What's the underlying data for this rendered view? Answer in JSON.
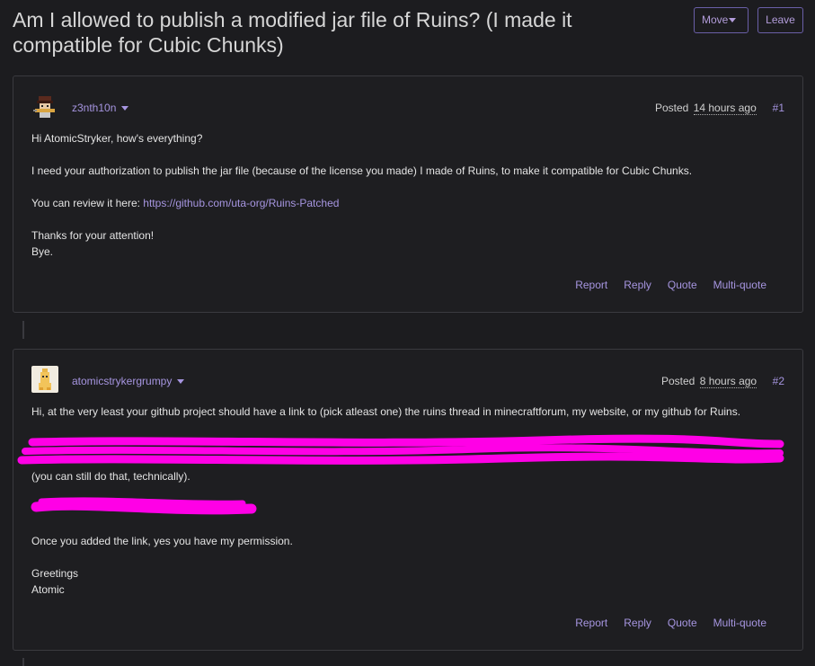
{
  "topic": {
    "title": "Am I allowed to publish a modified jar file of Ruins? (I made it compatible for Cubic Chunks)",
    "move_label": "Move",
    "leave_label": "Leave"
  },
  "posts": [
    {
      "username": "z3nth10n",
      "posted_prefix": "Posted",
      "posted_time": "14 hours ago",
      "number": "#1",
      "lines": [
        "Hi AtomicStryker, how's everything?",
        "I need your authorization to publish the jar file (because of the license you made) I made of Ruins, to make it compatible for Cubic Chunks.",
        "You can review it here: ",
        "Thanks for your attention!",
        "Bye."
      ],
      "link": "https://github.com/uta-org/Ruins-Patched",
      "actions": [
        "Report",
        "Reply",
        "Quote",
        "Multi-quote"
      ]
    },
    {
      "username": "atomicstrykergrumpy",
      "posted_prefix": "Posted",
      "posted_time": "8 hours ago",
      "number": "#2",
      "lines": [
        "Hi, at the very least your github project should have a link to (pick atleast one) the ruins thread in minecraftforum, my website, or my github for Ruins.",
        "(you can still do that, technically).",
        "Once you added the link, yes you have my permission.",
        "Greetings",
        "Atomic"
      ],
      "actions": [
        "Report",
        "Reply",
        "Quote",
        "Multi-quote"
      ]
    }
  ],
  "colors": {
    "background": "#1c1c1f",
    "accent": "#a695e0",
    "border": "#3a3a3f",
    "redaction": "#ff00e6"
  }
}
